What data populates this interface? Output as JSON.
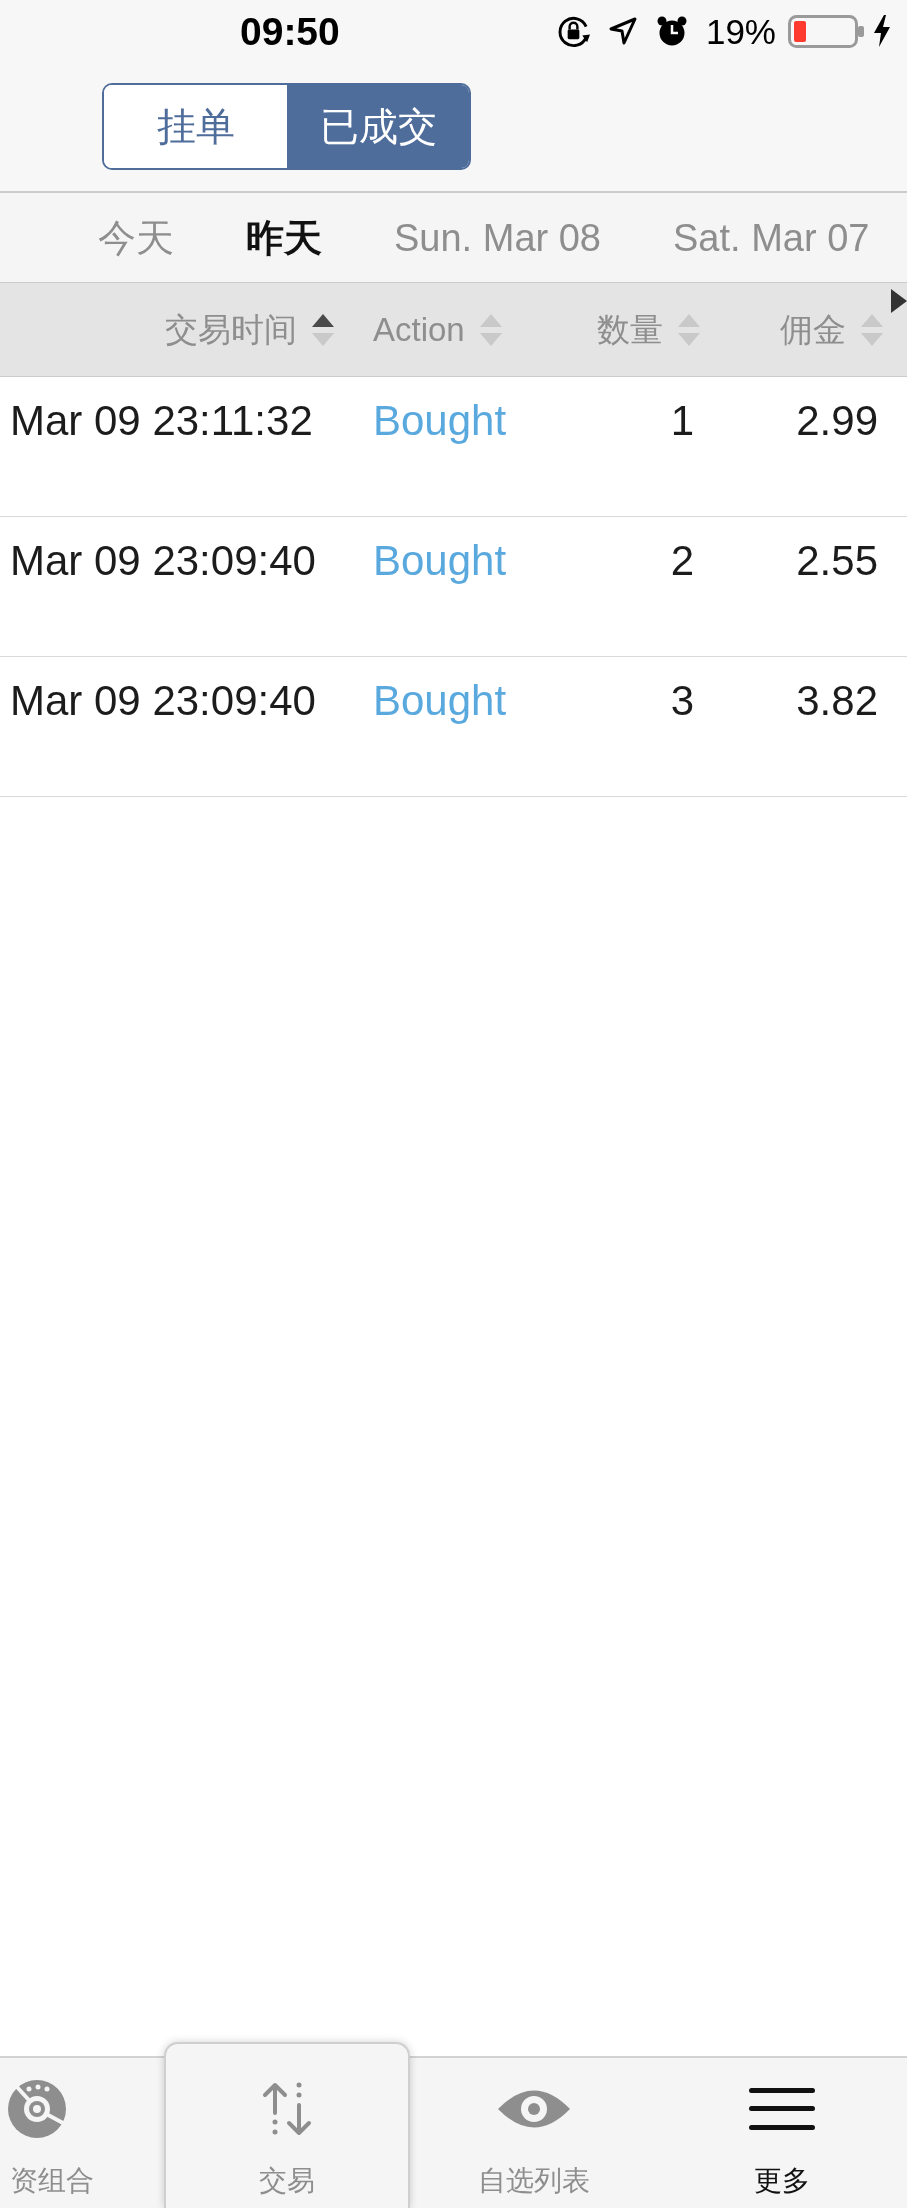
{
  "status_bar": {
    "time": "09:50",
    "battery": "19%"
  },
  "segmented_control": [
    {
      "label": "挂单",
      "selected": false
    },
    {
      "label": "已成交",
      "selected": true
    }
  ],
  "date_tabs": [
    {
      "label": "今天",
      "selected": false
    },
    {
      "label": "昨天",
      "selected": true
    },
    {
      "label": "Sun. Mar 08",
      "selected": false
    },
    {
      "label": "Sat. Mar 07",
      "selected": false
    }
  ],
  "table": {
    "columns": [
      {
        "label": "交易时间",
        "sorted": true
      },
      {
        "label": "Action",
        "sorted": false
      },
      {
        "label": "数量",
        "sorted": false
      },
      {
        "label": "佣金",
        "sorted": false
      }
    ],
    "rows": [
      [
        "Mar 09 23:11:32",
        "Bought",
        "1",
        "2.99"
      ],
      [
        "Mar 09 23:09:40",
        "Bought",
        "2",
        "2.55"
      ],
      [
        "Mar 09 23:09:40",
        "Bought",
        "3",
        "3.82"
      ]
    ]
  },
  "tab_bar": [
    {
      "label": "资组合",
      "kind": "normal",
      "selected": false
    },
    {
      "label": "交易",
      "kind": "raised",
      "selected": false
    },
    {
      "label": "自选列表",
      "kind": "normal",
      "selected": false
    },
    {
      "label": "更多",
      "kind": "normal",
      "selected": true
    }
  ]
}
